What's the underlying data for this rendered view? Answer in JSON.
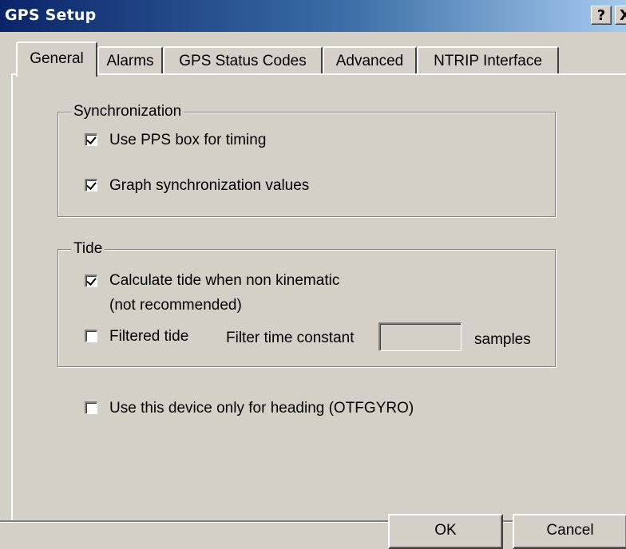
{
  "window": {
    "title": "GPS Setup",
    "help_label": "?",
    "close_label": "X"
  },
  "tabs": [
    {
      "label": "General",
      "active": true
    },
    {
      "label": "Alarms",
      "active": false
    },
    {
      "label": "GPS Status Codes",
      "active": false
    },
    {
      "label": "Advanced",
      "active": false
    },
    {
      "label": "NTRIP Interface",
      "active": false
    }
  ],
  "synchronization": {
    "label": "Synchronization",
    "use_pps": {
      "label": "Use PPS box for timing",
      "checked": true
    },
    "graph_sync": {
      "label": "Graph synchronization values",
      "checked": true
    }
  },
  "tide": {
    "label": "Tide",
    "calc_tide": {
      "label": "Calculate tide when non kinematic",
      "checked": true
    },
    "calc_tide_note": "(not recommended)",
    "filtered_tide": {
      "label": "Filtered tide",
      "checked": false
    },
    "filter_time_constant_label": "Filter time constant",
    "filter_time_constant_value": "",
    "samples_label": "samples"
  },
  "heading_only": {
    "label": "Use this device only for heading (OTFGYRO)",
    "checked": false
  },
  "buttons": {
    "ok": "OK",
    "cancel": "Cancel"
  }
}
